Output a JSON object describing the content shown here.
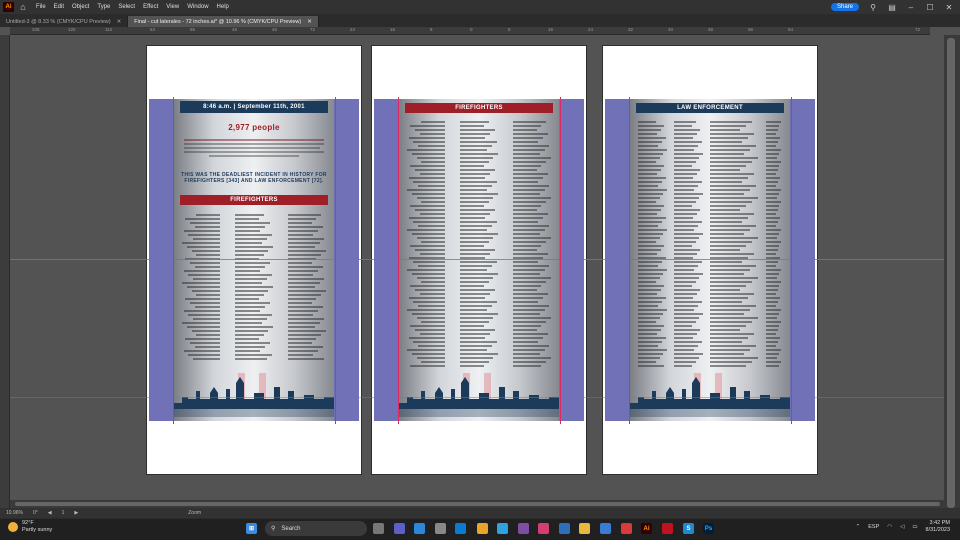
{
  "app": {
    "logo": "Ai",
    "menu": [
      "File",
      "Edit",
      "Object",
      "Type",
      "Select",
      "Effect",
      "View",
      "Window",
      "Help"
    ],
    "share_label": "Share"
  },
  "tabs": [
    {
      "label": "Untitled-3 @ 8.33 % (CMYK/CPU Preview)",
      "active": false
    },
    {
      "label": "Final - cut laterales - 72 inches.ai* @ 10.96 % (CMYK/CPU Preview)",
      "active": true
    }
  ],
  "ruler_ticks": [
    "328",
    "120",
    "112",
    "64",
    "56",
    "48",
    "40",
    "72",
    "24",
    "16",
    "8",
    "0",
    "8",
    "16",
    "24",
    "32",
    "40",
    "48",
    "56",
    "64",
    "72"
  ],
  "status": {
    "zoom": "10.96%",
    "angle": "0°",
    "artboard_nav": "1",
    "mode": "Zoom"
  },
  "artboards": [
    {
      "banner_main": "8:46 a.m. | September 11th, 2001",
      "headline": "2,977 people",
      "caption": "THIS WAS THE DEADLIEST INCIDENT IN HISTORY FOR FIREFIGHTERS [343] AND LAW ENFORCEMENT [72].",
      "section": "FIREFIGHTERS"
    },
    {
      "section": "FIREFIGHTERS"
    },
    {
      "section": "LAW ENFORCEMENT"
    }
  ],
  "colors": {
    "bleed": "#7071b7",
    "banner_dark": "#1c3a5a",
    "banner_red": "#9e1f28",
    "guide": "#ff3b5c"
  },
  "taskbar": {
    "weather": {
      "temp": "92°F",
      "desc": "Partly sunny"
    },
    "search_placeholder": "Search",
    "lang": "ESP",
    "time": "3:42 PM",
    "date": "8/31/2023"
  }
}
